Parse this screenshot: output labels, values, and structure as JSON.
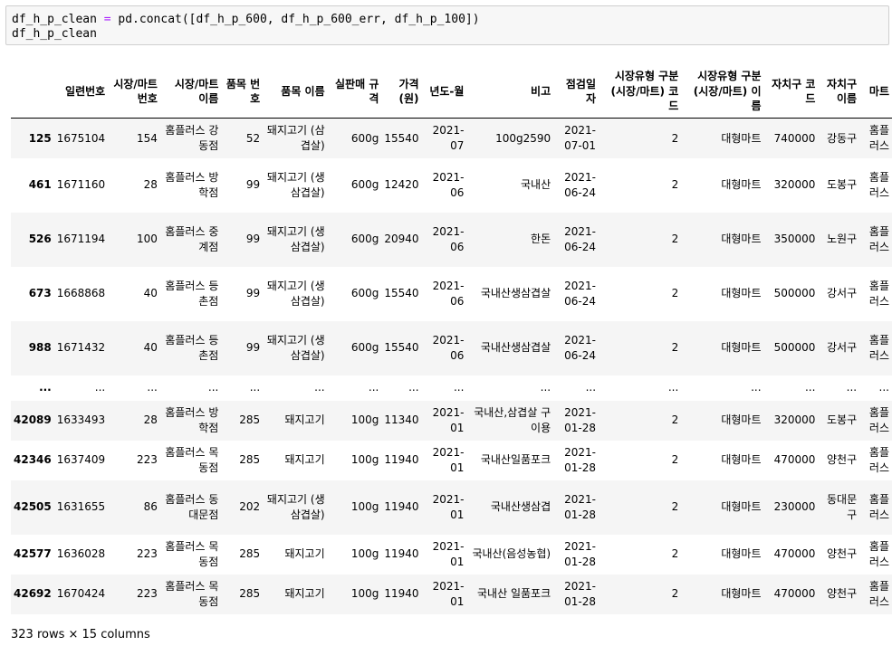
{
  "code": {
    "line1_a": "df_h_p_clean",
    "line1_eq": " = ",
    "line1_b": "pd.concat([df_h_p_600, df_h_p_600_err, df_h_p_100])",
    "line2": "df_h_p_clean"
  },
  "columns": [
    "",
    "일련번호",
    "시장/마트 번호",
    "시장/마트 이름",
    "품목 번호",
    "품목 이름",
    "실판매 규격",
    "가격(원)",
    "년도-월",
    "비고",
    "점검일자",
    "시장유형 구분(시장/마트) 코드",
    "시장유형 구분(시장/마트) 이름",
    "자치구 코드",
    "자치구 이름",
    "마트"
  ],
  "rows": [
    [
      "125",
      "1675104",
      "154",
      "홈플러스 강동점",
      "52",
      "돼지고기 (삼겹살)",
      "600g",
      "15540",
      "2021-07",
      "100g2590",
      "2021-07-01",
      "2",
      "대형마트",
      "740000",
      "강동구",
      "홈플러스"
    ],
    [
      "461",
      "1671160",
      "28",
      "홈플러스 방학점",
      "99",
      "돼지고기 (생삼겹살)",
      "600g",
      "12420",
      "2021-06",
      "국내산",
      "2021-06-24",
      "2",
      "대형마트",
      "320000",
      "도봉구",
      "홈플러스"
    ],
    [
      "526",
      "1671194",
      "100",
      "홈플러스 중계점",
      "99",
      "돼지고기 (생삼겹살)",
      "600g",
      "20940",
      "2021-06",
      "한돈",
      "2021-06-24",
      "2",
      "대형마트",
      "350000",
      "노원구",
      "홈플러스"
    ],
    [
      "673",
      "1668868",
      "40",
      "홈플러스 등촌점",
      "99",
      "돼지고기 (생삼겹살)",
      "600g",
      "15540",
      "2021-06",
      "국내산생삼겹살",
      "2021-06-24",
      "2",
      "대형마트",
      "500000",
      "강서구",
      "홈플러스"
    ],
    [
      "988",
      "1671432",
      "40",
      "홈플러스 등촌점",
      "99",
      "돼지고기 (생삼겹살)",
      "600g",
      "15540",
      "2021-06",
      "국내산생삼겹살",
      "2021-06-24",
      "2",
      "대형마트",
      "500000",
      "강서구",
      "홈플러스"
    ],
    [
      "...",
      "...",
      "...",
      "...",
      "...",
      "...",
      "...",
      "...",
      "...",
      "...",
      "...",
      "...",
      "...",
      "...",
      "...",
      "..."
    ],
    [
      "42089",
      "1633493",
      "28",
      "홈플러스 방학점",
      "285",
      "돼지고기",
      "100g",
      "11340",
      "2021-01",
      "국내산,삼겹살 구이용",
      "2021-01-28",
      "2",
      "대형마트",
      "320000",
      "도봉구",
      "홈플러스"
    ],
    [
      "42346",
      "1637409",
      "223",
      "홈플러스 목동점",
      "285",
      "돼지고기",
      "100g",
      "11940",
      "2021-01",
      "국내산일품포크",
      "2021-01-28",
      "2",
      "대형마트",
      "470000",
      "양천구",
      "홈플러스"
    ],
    [
      "42505",
      "1631655",
      "86",
      "홈플러스 동대문점",
      "202",
      "돼지고기 (생삼겹살)",
      "100g",
      "11940",
      "2021-01",
      "국내산생삼겹",
      "2021-01-28",
      "2",
      "대형마트",
      "230000",
      "동대문구",
      "홈플러스"
    ],
    [
      "42577",
      "1636028",
      "223",
      "홈플러스 목동점",
      "285",
      "돼지고기",
      "100g",
      "11940",
      "2021-01",
      "국내산(음성농협)",
      "2021-01-28",
      "2",
      "대형마트",
      "470000",
      "양천구",
      "홈플러스"
    ],
    [
      "42692",
      "1670424",
      "223",
      "홈플러스 목동점",
      "285",
      "돼지고기",
      "100g",
      "11940",
      "2021-01",
      "국내산 일품포크",
      "2021-01-28",
      "2",
      "대형마트",
      "470000",
      "양천구",
      "홈플러스"
    ]
  ],
  "shape": "323 rows × 15 columns"
}
